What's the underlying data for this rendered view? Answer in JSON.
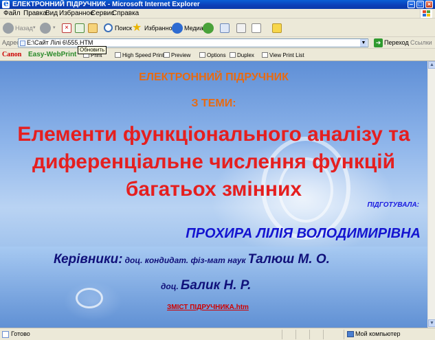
{
  "window": {
    "title": "ЕЛЕКТРОННИЙ ПІДРУЧНИК - Microsoft Internet Explorer",
    "minimize": "–",
    "maximize": "□",
    "close": "×"
  },
  "menu": [
    "Файл",
    "Правка",
    "Вид",
    "Избранное",
    "Сервис",
    "Справка"
  ],
  "toolbar": {
    "back": "Назад",
    "search": "Поиск",
    "favorites": "Избранное",
    "media": "Медиа"
  },
  "tooltip": "Обновить",
  "address": {
    "label": "Адрес",
    "value": "E:\\Сайт Лілі 6\\555.HTM",
    "go": "Переход",
    "links": "Ссылки"
  },
  "canon": {
    "logo": "Canon",
    "product": "Easy-WebPrint",
    "print": "Print",
    "high_speed": "High Speed Print",
    "preview": "Preview",
    "options": "Options",
    "duplex": "Duplex",
    "view_list": "View Print List"
  },
  "content": {
    "heading1": "ЕЛЕКТРОННИЙ ПІДРУЧНИК",
    "heading2": "З ТЕМИ:",
    "title_lines": [
      "Елементи функціонального аналізу та",
      "диференціальне числення функцій",
      "багатьох змінних"
    ],
    "prepared_label": "ПІДГОТУВАЛА:",
    "author": "ПРОХИРА ЛІЛІЯ ВОЛОДИМИРІВНА",
    "supervisors_label": "Керівники:",
    "supervisor1_title": "доц. кондидат. фіз-мат наук",
    "supervisor1_name": "Талюш М. О.",
    "supervisor2_title": "доц.",
    "supervisor2_name": "Балик Н. Р.",
    "link": "ЗМІСТ ПІДРУЧНИКА.htm"
  },
  "status": {
    "left": "Готово",
    "right": "Мой компьютер"
  }
}
